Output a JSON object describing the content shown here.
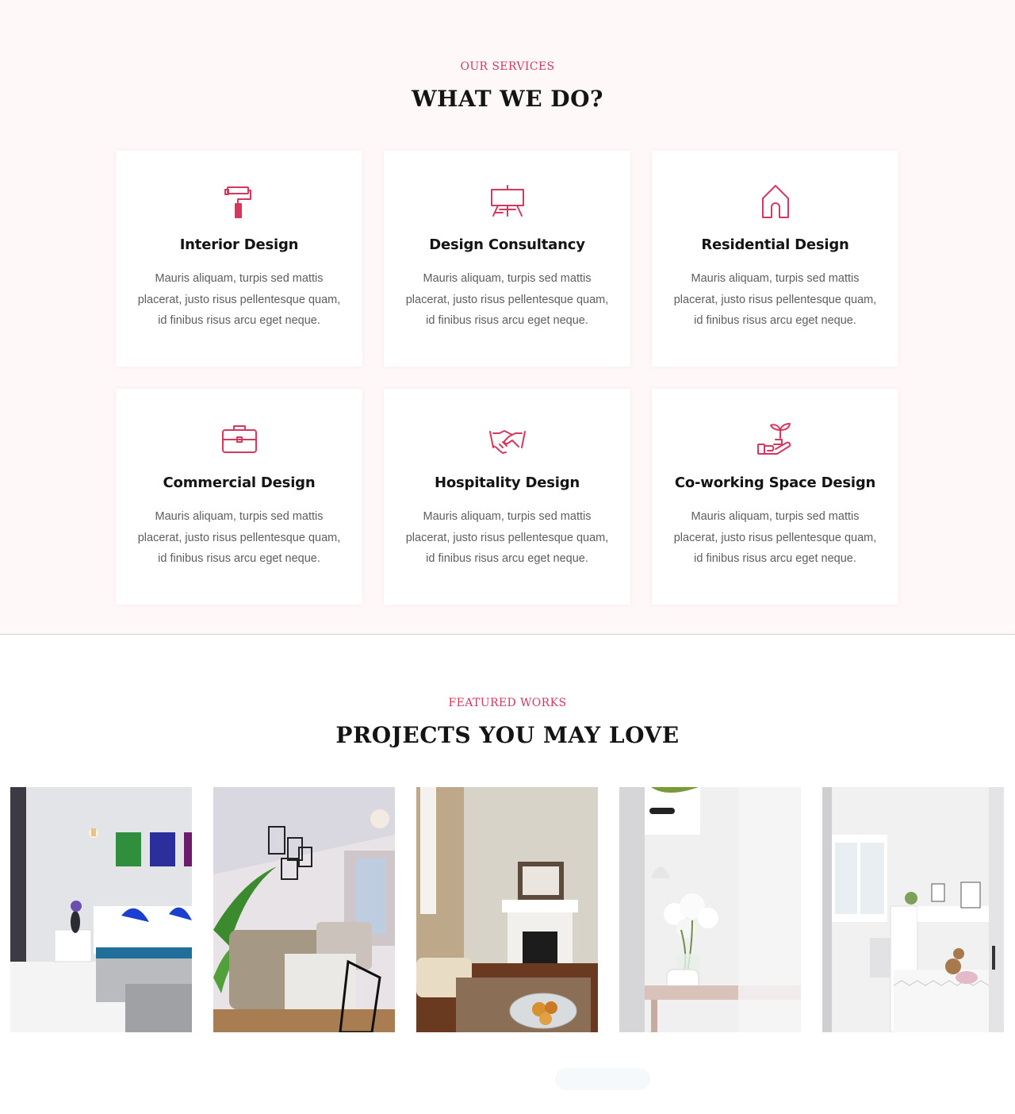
{
  "services": {
    "eyebrow": "OUR SERVICES",
    "heading": "WHAT WE DO?",
    "accent_color": "#d6385d",
    "items": [
      {
        "icon": "paint-roller-icon",
        "title": "Interior Design",
        "desc": "Mauris aliquam, turpis sed mattis placerat, justo risus pellentesque quam, id finibus risus arcu eget neque."
      },
      {
        "icon": "easel-icon",
        "title": "Design Consultancy",
        "desc": "Mauris aliquam, turpis sed mattis placerat, justo risus pellentesque quam, id finibus risus arcu eget neque."
      },
      {
        "icon": "house-icon",
        "title": "Residential Design",
        "desc": "Mauris aliquam, turpis sed mattis placerat, justo risus pellentesque quam, id finibus risus arcu eget neque."
      },
      {
        "icon": "briefcase-icon",
        "title": "Commercial Design",
        "desc": "Mauris aliquam, turpis sed mattis placerat, justo risus pellentesque quam, id finibus risus arcu eget neque."
      },
      {
        "icon": "handshake-icon",
        "title": "Hospitality Design",
        "desc": "Mauris aliquam, turpis sed mattis placerat, justo risus pellentesque quam, id finibus risus arcu eget neque."
      },
      {
        "icon": "plant-hand-icon",
        "title": "Co-working Space Design",
        "desc": "Mauris aliquam, turpis sed mattis placerat, justo risus pellentesque quam, id finibus risus arcu eget neque."
      }
    ]
  },
  "works": {
    "eyebrow": "FEATURED WORKS",
    "heading": "PROJECTS YOU MAY LOVE",
    "projects": [
      {
        "scene": "bedroom-photo"
      },
      {
        "scene": "living-room-photo"
      },
      {
        "scene": "fireplace-lounge-photo"
      },
      {
        "scene": "flower-vase-photo"
      },
      {
        "scene": "kids-room-photo"
      }
    ]
  }
}
